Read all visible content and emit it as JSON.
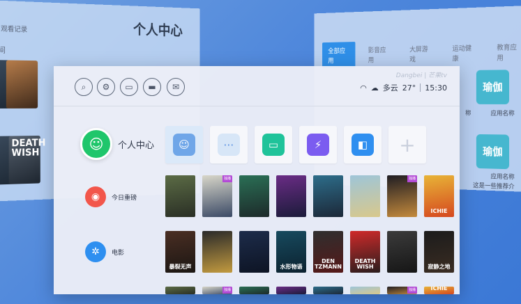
{
  "background": {
    "left_panel": {
      "title": "个人中心",
      "subtitle": "观看记录",
      "subtitle2": "间"
    },
    "right_panel": {
      "tabs": [
        "全部应用",
        "影音应用",
        "大屏游戏",
        "运动健康",
        "教育应用"
      ],
      "app_icon_text": "瑜伽",
      "app_name": "应用名称",
      "app_name_partial": "称",
      "app_meta": "这是一些推荐介"
    },
    "left_posters": [
      "",
      "",
      "DEATH WISH"
    ]
  },
  "main": {
    "brand": "Dangbei | 芒果tv",
    "weather_text": "多云",
    "temperature": "27°",
    "time": "15:30",
    "nav": [
      {
        "label": "个人中心",
        "icon": "user-icon",
        "color": "#1fc66b"
      },
      {
        "label": "今日重磅",
        "icon": "flame-icon",
        "color": "#f2564b"
      },
      {
        "label": "电影",
        "icon": "film-reel-icon",
        "color": "#2e8ff0"
      }
    ],
    "top_icons": [
      "search-icon",
      "settings-icon",
      "folder-icon",
      "hdmi-icon",
      "message-icon"
    ],
    "tiles": [
      {
        "name": "user-illustration",
        "color": "#dbe9f9"
      },
      {
        "name": "apps-grid",
        "color": "#e7ecf7"
      },
      {
        "name": "file-manager",
        "color": "#1fc39a"
      },
      {
        "name": "security-shield",
        "color": "#7b5cf0"
      },
      {
        "name": "screen-cast",
        "color": "#2f8ff0"
      },
      {
        "name": "add-tile",
        "color": "#f6f7fb"
      }
    ],
    "posters_row1": [
      {
        "text": "",
        "colors": [
          "#5b6b45",
          "#2a2f25"
        ]
      },
      {
        "text": "",
        "colors": [
          "#d8d6c9",
          "#3b4a66"
        ],
        "tag": "独播"
      },
      {
        "text": "",
        "colors": [
          "#2a6f55",
          "#1d2a2a"
        ]
      },
      {
        "text": "",
        "colors": [
          "#6a2c85",
          "#1b1b3a"
        ]
      },
      {
        "text": "",
        "colors": [
          "#2d6d8a",
          "#1c2838"
        ]
      },
      {
        "text": "",
        "colors": [
          "#9ec5d8",
          "#d8c88c"
        ]
      },
      {
        "text": "",
        "colors": [
          "#1f1d23",
          "#c48a3c"
        ],
        "tag": "独播"
      },
      {
        "text": "ICHIE",
        "colors": [
          "#e8b437",
          "#d5481f"
        ]
      }
    ],
    "posters_row2": [
      {
        "text": "暴裂无声",
        "colors": [
          "#4a2e23",
          "#1b1613"
        ]
      },
      {
        "text": "",
        "colors": [
          "#2a2a2a",
          "#c29a3f"
        ]
      },
      {
        "text": "",
        "colors": [
          "#1d2c4a",
          "#0d1424"
        ]
      },
      {
        "text": "水形物语",
        "colors": [
          "#174a5e",
          "#0c2230"
        ]
      },
      {
        "text": "DEN TZMANN",
        "colors": [
          "#2f2f2f",
          "#551818"
        ]
      },
      {
        "text": "DEATH WISH",
        "colors": [
          "#cf2a2a",
          "#2a1d1d"
        ]
      },
      {
        "text": "",
        "colors": [
          "#3b3b3b",
          "#161616"
        ]
      },
      {
        "text": "寂静之地",
        "colors": [
          "#1c1c1c",
          "#3a2c22"
        ]
      }
    ]
  }
}
